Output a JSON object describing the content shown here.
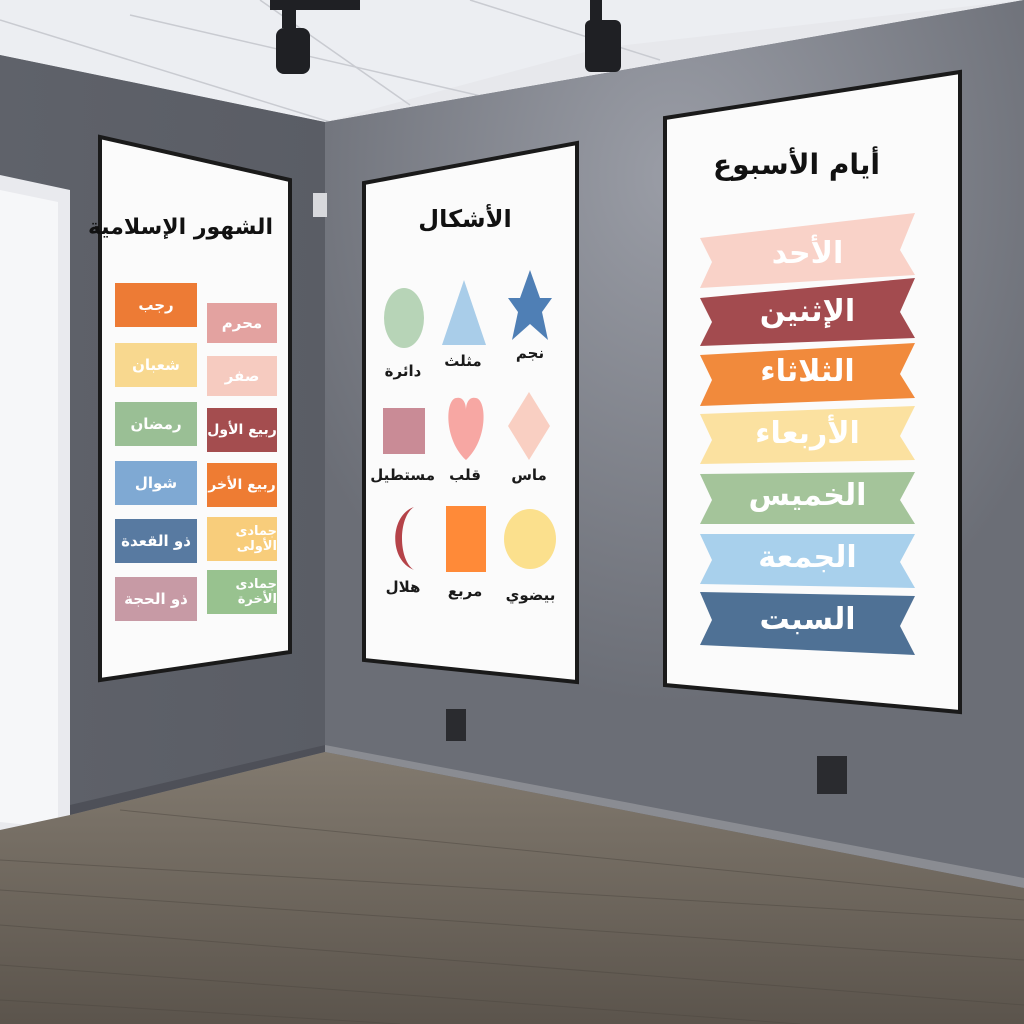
{
  "posters": {
    "months": {
      "title": "الشهور الإسلامية",
      "items": [
        {
          "label": "محرم",
          "color": "#e3a2a0"
        },
        {
          "label": "رجب",
          "color": "#ed7b35"
        },
        {
          "label": "صفر",
          "color": "#f6cbc0"
        },
        {
          "label": "شعبان",
          "color": "#f8d88f"
        },
        {
          "label": "ربيع الأول",
          "color": "#a44d4f"
        },
        {
          "label": "رمضان",
          "color": "#9abf95"
        },
        {
          "label": "ربيع الأخر",
          "color": "#ee7c33"
        },
        {
          "label": "شوال",
          "color": "#7fa9d3"
        },
        {
          "label": "جمادى الأولى",
          "color": "#f8cd7b"
        },
        {
          "label": "ذو القعدة",
          "color": "#587aa1"
        },
        {
          "label": "جمادى الأخرة",
          "color": "#98c28f"
        },
        {
          "label": "ذو الحجة",
          "color": "#c79aa5"
        }
      ]
    },
    "shapes": {
      "title": "الأشكال",
      "items": [
        {
          "label": "نجم",
          "icon": "star-icon",
          "color": "#4f7fb5"
        },
        {
          "label": "مثلث",
          "icon": "triangle-icon",
          "color": "#a9cde9"
        },
        {
          "label": "دائرة",
          "icon": "circle-icon",
          "color": "#b7d4b7"
        },
        {
          "label": "ماس",
          "icon": "diamond-icon",
          "color": "#f9cfc2"
        },
        {
          "label": "قلب",
          "icon": "heart-icon",
          "color": "#f7a7a3"
        },
        {
          "label": "مستطيل",
          "icon": "rectangle-icon",
          "color": "#c98b96"
        },
        {
          "label": "بيضوي",
          "icon": "oval-icon",
          "color": "#fbe08d"
        },
        {
          "label": "مربع",
          "icon": "square-icon",
          "color": "#ff8a38"
        },
        {
          "label": "هلال",
          "icon": "crescent-icon",
          "color": "#b54349"
        }
      ]
    },
    "days": {
      "title": "أيام الأسبوع",
      "items": [
        {
          "label": "الأحد",
          "color": "#f9d2c8"
        },
        {
          "label": "الإثنين",
          "color": "#a34b4f"
        },
        {
          "label": "الثلاثاء",
          "color": "#f18a3c"
        },
        {
          "label": "الأربعاء",
          "color": "#fbe1a0"
        },
        {
          "label": "الخميس",
          "color": "#a4c49a"
        },
        {
          "label": "الجمعة",
          "color": "#a8d0ec"
        },
        {
          "label": "السبت",
          "color": "#4f7195"
        }
      ]
    }
  }
}
